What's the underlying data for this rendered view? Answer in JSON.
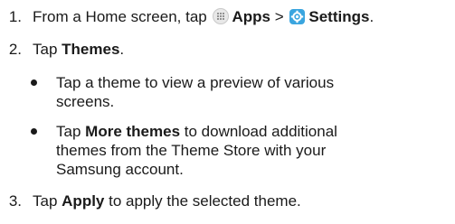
{
  "steps": [
    {
      "number": "1.",
      "prefix": "From a Home screen, tap",
      "apps_label": "Apps",
      "separator": ">",
      "settings_label": "Settings",
      "suffix": "."
    },
    {
      "number": "2.",
      "prefix": "Tap",
      "bold": "Themes",
      "suffix": "."
    },
    {
      "number": "3.",
      "prefix": "Tap",
      "bold": "Apply",
      "suffix": "to apply the selected theme."
    }
  ],
  "bullets": [
    {
      "line1": "Tap a theme to view a preview of various",
      "line2": "screens."
    },
    {
      "prefix": "Tap",
      "bold": "More themes",
      "line1_rest": "to download additional",
      "line2": "themes from the Theme Store with your",
      "line3": "Samsung account."
    }
  ]
}
